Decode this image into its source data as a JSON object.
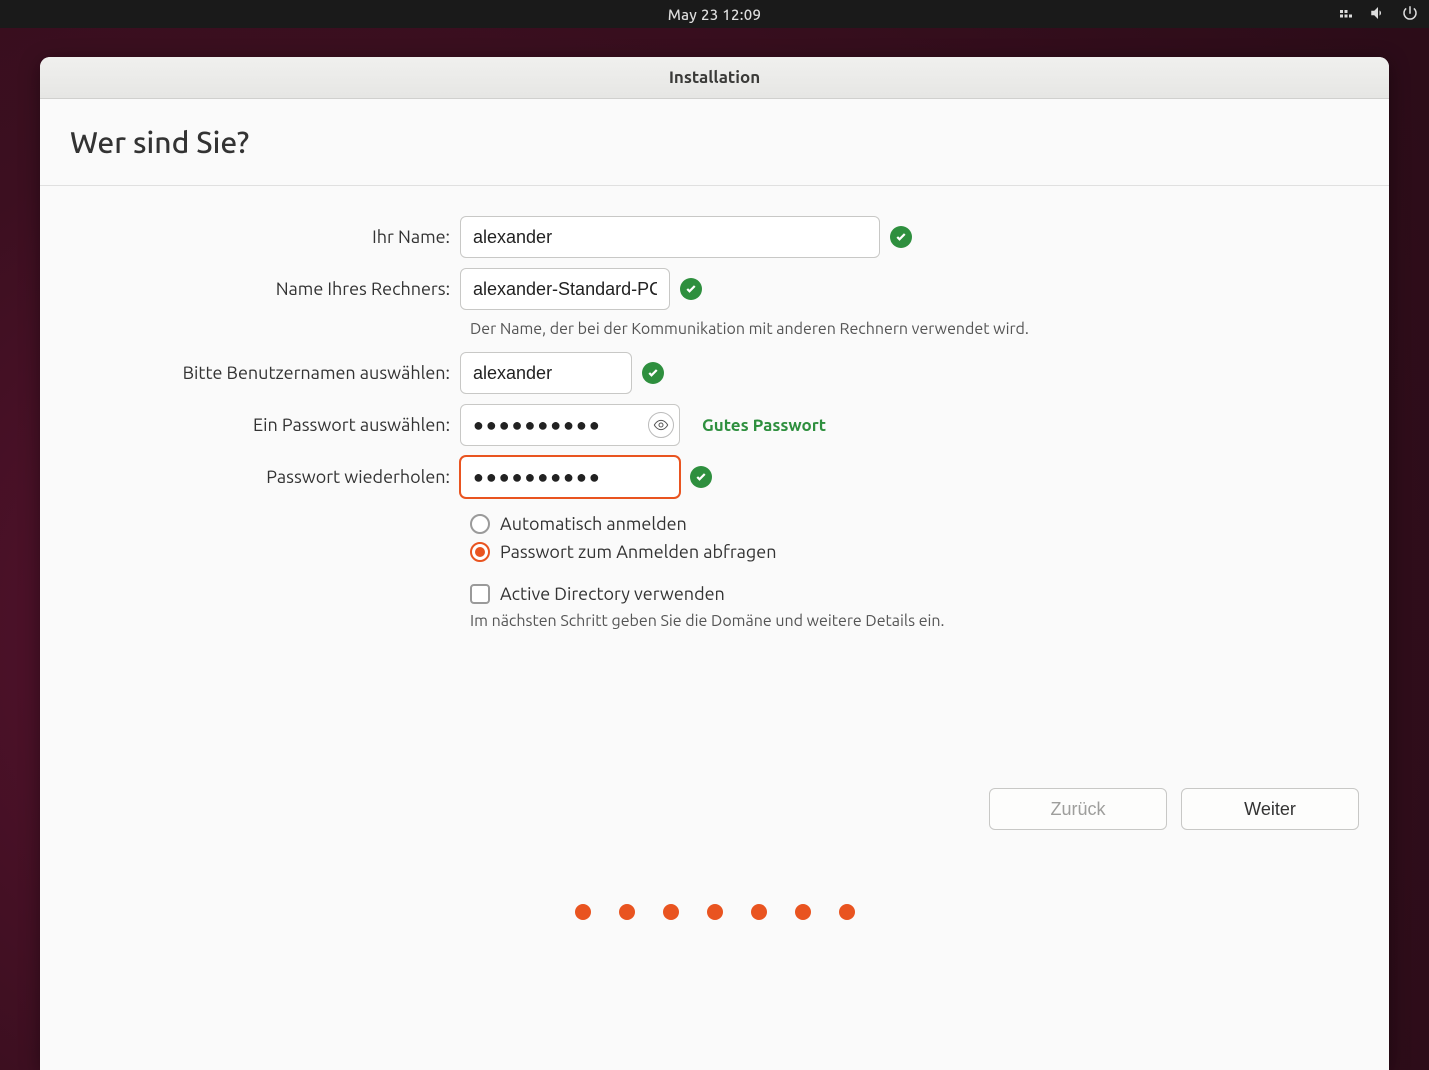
{
  "topbar": {
    "clock": "May 23  12:09"
  },
  "window": {
    "title": "Installation"
  },
  "page": {
    "title": "Wer sind Sie?"
  },
  "form": {
    "name": {
      "label": "Ihr Name:",
      "value": "alexander"
    },
    "hostname": {
      "label": "Name Ihres Rechners:",
      "value": "alexander-Standard-PC",
      "helper": "Der Name, der bei der Kommunikation mit anderen Rechnern verwendet wird."
    },
    "username": {
      "label": "Bitte Benutzernamen auswählen:",
      "value": "alexander"
    },
    "password": {
      "label": "Ein Passwort auswählen:",
      "value": "●●●●●●●●●●",
      "strength": "Gutes Passwort"
    },
    "confirm": {
      "label": "Passwort wiederholen:",
      "value": "●●●●●●●●●●"
    },
    "login": {
      "auto": "Automatisch anmelden",
      "require_pw": "Passwort zum Anmelden abfragen"
    },
    "ad": {
      "label": "Active Directory verwenden",
      "helper": "Im nächsten Schritt geben Sie die Domäne und weitere Details ein."
    }
  },
  "buttons": {
    "back": "Zurück",
    "next": "Weiter"
  },
  "progress": {
    "total": 7
  }
}
